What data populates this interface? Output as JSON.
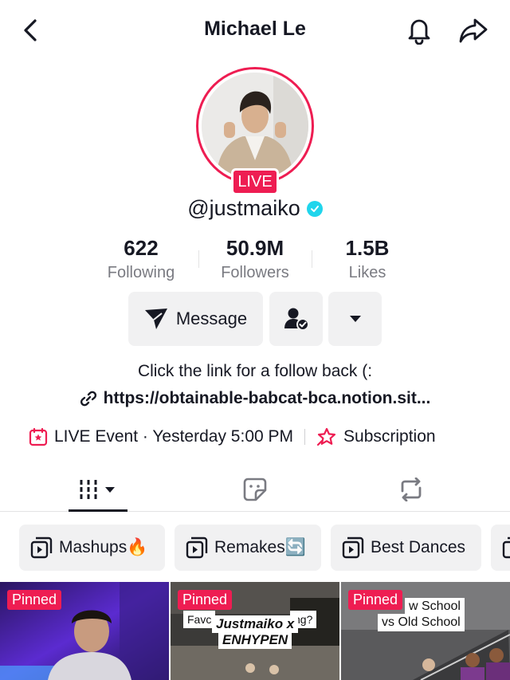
{
  "header": {
    "title": "Michael Le"
  },
  "profile": {
    "live_label": "LIVE",
    "handle": "@justmaiko"
  },
  "stats": [
    {
      "value": "622",
      "label": "Following"
    },
    {
      "value": "50.9M",
      "label": "Followers"
    },
    {
      "value": "1.5B",
      "label": "Likes"
    }
  ],
  "actions": {
    "message_label": "Message"
  },
  "bio": {
    "text": "Click the link for a follow back (:",
    "link": "https://obtainable-babcat-bca.notion.sit..."
  },
  "event": {
    "live_event": "LIVE Event · Yesterday 5:00 PM",
    "subscription": "Subscription"
  },
  "playlists": [
    {
      "label": "Mashups🔥"
    },
    {
      "label": "Remakes🔄"
    },
    {
      "label": "Best Dances"
    }
  ],
  "videos": [
    {
      "badge": "Pinned",
      "captions": []
    },
    {
      "badge": "Pinned",
      "captions": [
        "Favc",
        "Justmaiko x",
        "ENHYPEN",
        "ng?"
      ]
    },
    {
      "badge": "Pinned",
      "captions": [
        "w School",
        "vs Old School"
      ]
    }
  ],
  "colors": {
    "accent": "#ee1d52",
    "verified": "#20d5ec",
    "muted": "#7a7b82",
    "pill_bg": "#f1f1f2"
  }
}
